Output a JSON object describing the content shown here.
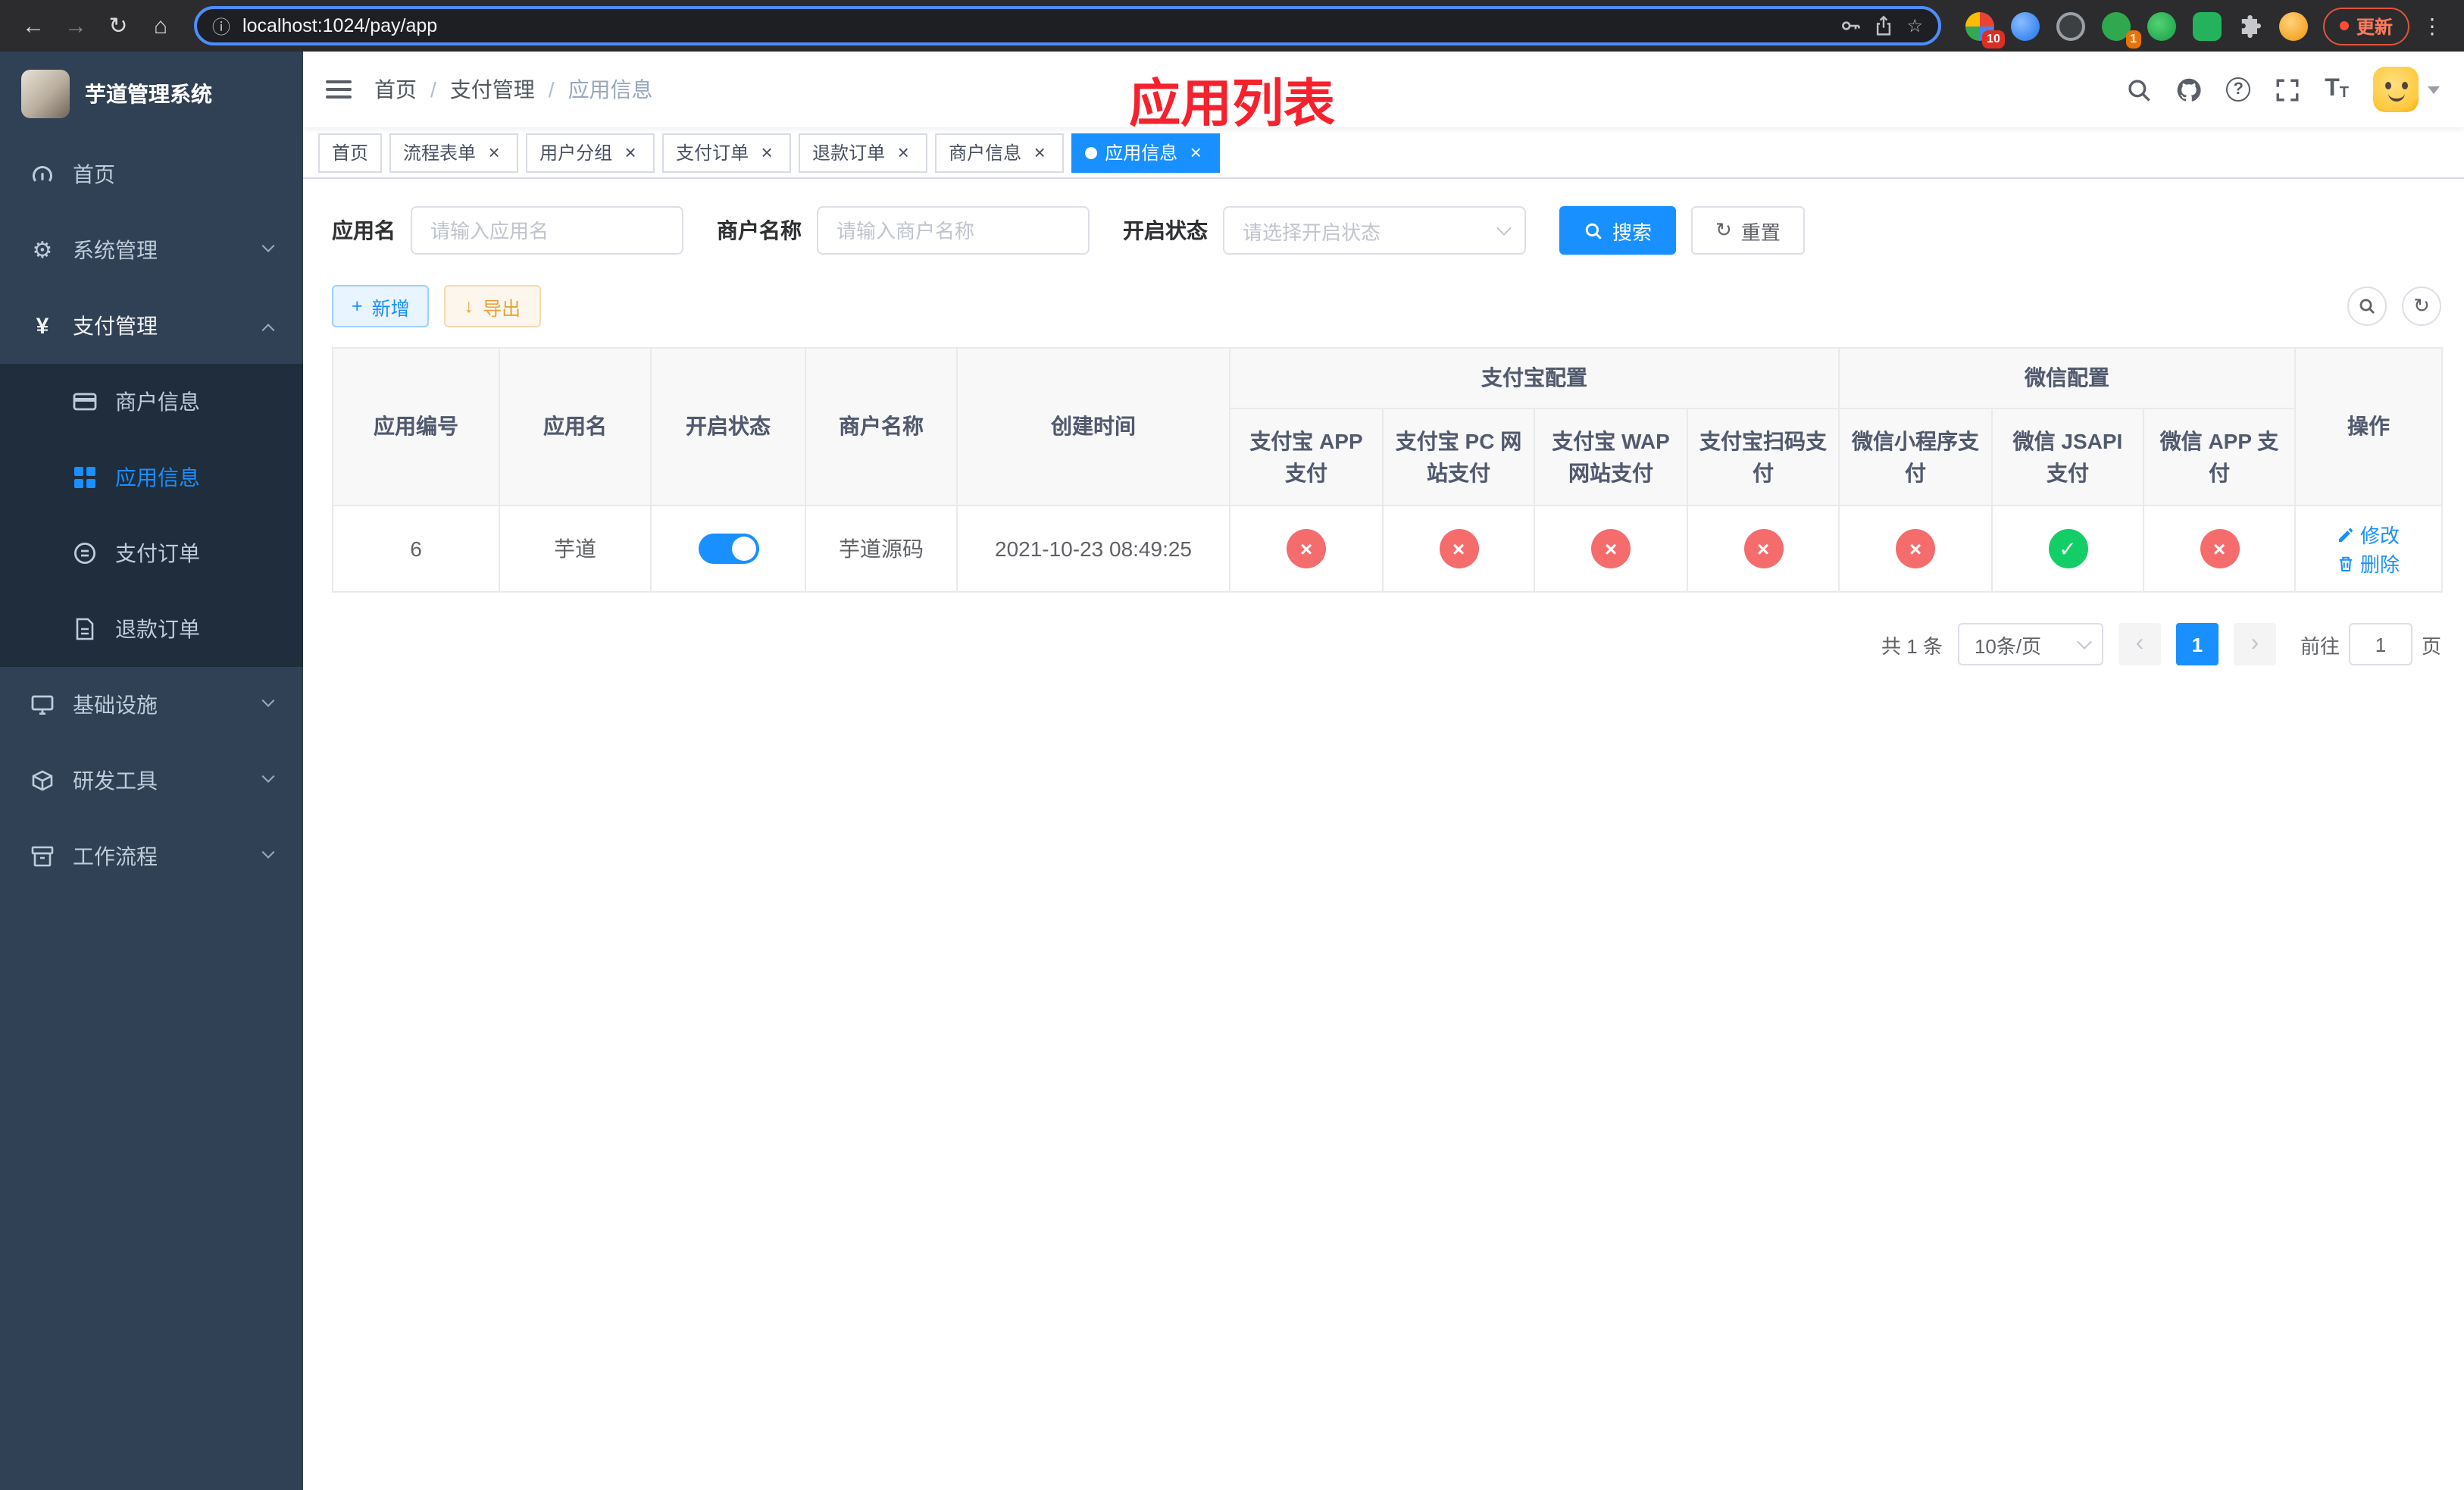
{
  "browser": {
    "url": "localhost:1024/pay/app",
    "update_label": "更新",
    "ext_badge_1": "10",
    "ext_badge_2": "1"
  },
  "app": {
    "logo_title": "芋道管理系统"
  },
  "sidebar": {
    "items": [
      {
        "label": "首页"
      },
      {
        "label": "系统管理"
      },
      {
        "label": "支付管理"
      },
      {
        "label": "商户信息"
      },
      {
        "label": "应用信息"
      },
      {
        "label": "支付订单"
      },
      {
        "label": "退款订单"
      },
      {
        "label": "基础设施"
      },
      {
        "label": "研发工具"
      },
      {
        "label": "工作流程"
      }
    ]
  },
  "breadcrumb": {
    "items": [
      "首页",
      "支付管理",
      "应用信息"
    ],
    "separator": "/"
  },
  "annotation": {
    "text": "应用列表",
    "color": "#f5222d"
  },
  "tabs": [
    {
      "label": "首页"
    },
    {
      "label": "流程表单"
    },
    {
      "label": "用户分组"
    },
    {
      "label": "支付订单"
    },
    {
      "label": "退款订单"
    },
    {
      "label": "商户信息"
    },
    {
      "label": "应用信息"
    }
  ],
  "filters": {
    "app_name_label": "应用名",
    "app_name_placeholder": "请输入应用名",
    "merchant_label": "商户名称",
    "merchant_placeholder": "请输入商户名称",
    "status_label": "开启状态",
    "status_placeholder": "请选择开启状态",
    "search_label": "搜索",
    "reset_label": "重置"
  },
  "toolbar": {
    "add_label": "新增",
    "export_label": "导出"
  },
  "table": {
    "columns": {
      "app_id": "应用编号",
      "app_name": "应用名",
      "status": "开启状态",
      "merchant": "商户名称",
      "create_time": "创建时间",
      "alipay_group": "支付宝配置",
      "alipay_app": "支付宝 APP 支付",
      "alipay_pc": "支付宝 PC 网站支付",
      "alipay_wap": "支付宝 WAP 网站支付",
      "alipay_qr": "支付宝扫码支付",
      "wx_group": "微信配置",
      "wx_lite": "微信小程序支付",
      "wx_jsapi": "微信 JSAPI 支付",
      "wx_app": "微信 APP 支付",
      "ops": "操作"
    },
    "rows": [
      {
        "app_id": "6",
        "app_name": "芋道",
        "status_on": true,
        "merchant": "芋道源码",
        "create_time": "2021-10-23 08:49:25",
        "alipay_app": "disabled",
        "alipay_pc": "disabled",
        "alipay_wap": "disabled",
        "alipay_qr": "disabled",
        "wx_lite": "disabled",
        "wx_jsapi": "enabled",
        "wx_app": "disabled",
        "edit_label": "修改",
        "delete_label": "删除"
      }
    ]
  },
  "pagination": {
    "total_text": "共 1 条",
    "page_size": "10条/页",
    "current_page": "1",
    "goto_prefix": "前往",
    "goto_value": "1",
    "goto_suffix": "页"
  },
  "theme": {
    "primary": "#1890ff",
    "danger": "#f56c6c",
    "success": "#13ce66",
    "sidebar_bg": "#304156",
    "submenu_bg": "#1f2d3d"
  },
  "icons": {
    "back": "←",
    "forward": "→",
    "reload": "↻",
    "home": "⌂",
    "info": "ⓘ",
    "star": "☆",
    "kebab": "⋮",
    "gear": "⚙",
    "yen": "¥",
    "close": "×",
    "check": "✓",
    "cross": "×",
    "plus": "+",
    "download": "↓",
    "refresh": "↻",
    "prev": "‹",
    "next": "›",
    "question": "?",
    "font_t": "T"
  }
}
